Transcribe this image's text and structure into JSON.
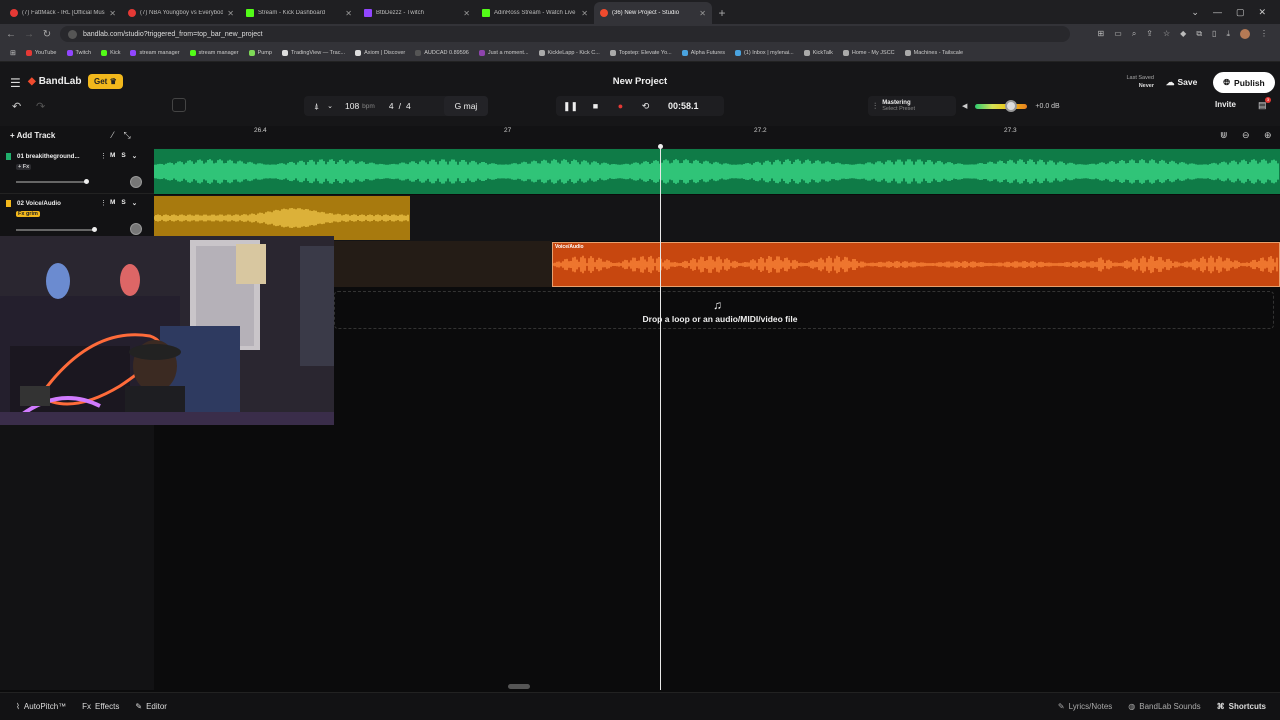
{
  "browser": {
    "tabs": [
      {
        "label": "(7) FattMack - IRL [Official Music",
        "color": "#e53935"
      },
      {
        "label": "(7) NBA Youngboy vs Everybody",
        "color": "#e53935"
      },
      {
        "label": "Stream - Kick Dashboard",
        "color": "#53fc18"
      },
      {
        "label": "BtbDezzz - Twitch",
        "color": "#9146ff"
      },
      {
        "label": "AdinRoss Stream - Watch Live",
        "color": "#53fc18"
      },
      {
        "label": "(36) New Project - Studio",
        "color": "#f04b2e"
      }
    ],
    "url": "bandlab.com/studio?triggered_from=top_bar_new_project",
    "bookmarks": [
      {
        "label": "YouTube",
        "color": "#e53935"
      },
      {
        "label": "Twitch",
        "color": "#9146ff"
      },
      {
        "label": "Kick",
        "color": "#53fc18"
      },
      {
        "label": "stream manager",
        "color": "#9146ff"
      },
      {
        "label": "stream manager",
        "color": "#53fc18"
      },
      {
        "label": "Pump",
        "color": "#7ed957"
      },
      {
        "label": "TradingView — Trac...",
        "color": "#ddd"
      },
      {
        "label": "Axiom | Discover",
        "color": "#ddd"
      },
      {
        "label": "AUDCAD 0.89596",
        "color": "#555"
      },
      {
        "label": "Just a moment...",
        "color": "#8e44ad"
      },
      {
        "label": "KickleLapp - Kick C...",
        "color": "#aaa"
      },
      {
        "label": "Topstep: Elevate Yo...",
        "color": "#aaa"
      },
      {
        "label": "Alpha Futures",
        "color": "#4aa3df"
      },
      {
        "label": "(1) Inbox | mylenai...",
        "color": "#4aa3df"
      },
      {
        "label": "KickTalk",
        "color": "#aaa"
      },
      {
        "label": "Home - My JSCC",
        "color": "#aaa"
      },
      {
        "label": "Machines - Tailscale",
        "color": "#aaa"
      }
    ]
  },
  "app": {
    "logo": "BandLab",
    "get_label": "Get",
    "project_title": "New Project",
    "last_saved_label": "Last Saved",
    "last_saved_value": "Never",
    "save_label": "Save",
    "publish_label": "Publish",
    "invite_label": "Invite",
    "notif_count": "3"
  },
  "transport": {
    "bpm": "108",
    "bpm_unit": "bpm",
    "time_sig_num": "4",
    "time_sig_den": "4",
    "key": "G maj",
    "time": "00:58.1"
  },
  "mastering": {
    "title": "Mastering",
    "subtitle": "Select Preset"
  },
  "volume": {
    "db": "+0.0 dB",
    "level": 0.55
  },
  "tracks_header": {
    "add_track": "Add Track"
  },
  "ruler": [
    "26.4",
    "27",
    "27.2",
    "27.3"
  ],
  "tracks": [
    {
      "num": "01",
      "name": "breakitheground...",
      "mute": "M",
      "solo": "S",
      "fx": "+ Fx",
      "color": "#1fae6b"
    },
    {
      "num": "02",
      "name": "Voice/Audio",
      "mute": "M",
      "solo": "S",
      "fx": "Fx grim",
      "color": "#f2b81c"
    }
  ],
  "clips": {
    "orange_label": "Voice/Audio"
  },
  "dropzone": {
    "text": "Drop a loop or an audio/MIDI/video file"
  },
  "footer": {
    "autopitch": "AutoPitch™",
    "effects": "Effects",
    "editor": "Editor",
    "lyrics": "Lyrics/Notes",
    "sounds": "BandLab Sounds",
    "shortcuts": "Shortcuts"
  }
}
